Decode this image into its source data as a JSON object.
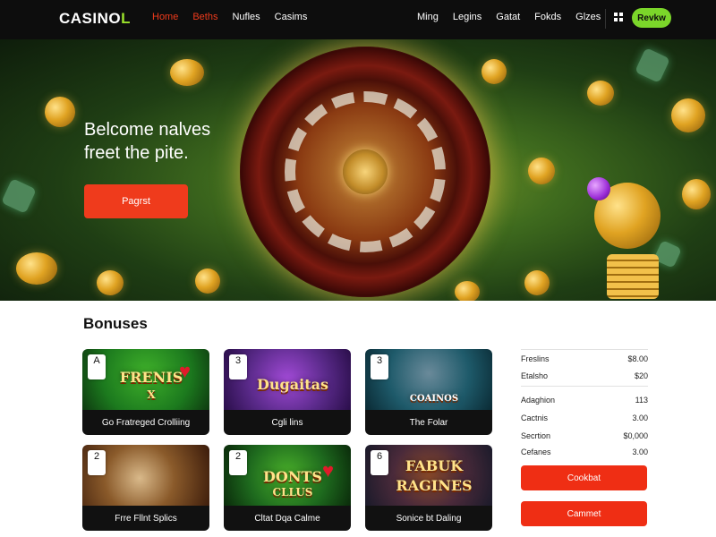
{
  "brand": {
    "logo_main": "CASINO",
    "logo_accent": "L",
    "accent_color": "#9be22b"
  },
  "nav": {
    "left_links": [
      {
        "label": "Home",
        "color": "#ef3b1c"
      },
      {
        "label": "Beths",
        "color": "#ef3b1c"
      },
      {
        "label": "Nufles",
        "color": "#ffffff"
      },
      {
        "label": "Casims",
        "color": "#ffffff"
      }
    ],
    "right_links": [
      "Ming",
      "Legins",
      "Gatat",
      "Fokds",
      "Glzes"
    ],
    "grid_icon": "grid-icon",
    "review_button": "Revkw"
  },
  "hero": {
    "title_line1": "Belcome nalves",
    "title_line2": "freet the pite.",
    "cta_label": "Pagrst"
  },
  "bonuses": {
    "title": "Bonuses",
    "cards": [
      {
        "art_text": "FRENIS",
        "art_sub": "X",
        "card_rank": "A",
        "caption": "Go Fratreged Crolliing",
        "bg": "#1c7a1e"
      },
      {
        "art_text": "Dugaitas",
        "art_sub": "",
        "card_rank": "3",
        "caption": "Cgli lins",
        "bg": "#5a2a8a"
      },
      {
        "art_text": "COAINOS",
        "art_sub": "",
        "card_rank": "3",
        "caption": "The Folar",
        "bg": "#1e5a6a"
      },
      {
        "art_text": "",
        "art_sub": "",
        "card_rank": "2",
        "caption": "Frre Fllnt Splics",
        "bg": "#6a3a1a"
      },
      {
        "art_text": "DONTS",
        "art_sub": "CLLUS",
        "card_rank": "2",
        "caption": "Cltat Dqa Calme",
        "bg": "#1e6a1e"
      },
      {
        "art_text": "FABUK",
        "art_sub": "RAGINES",
        "card_rank": "6",
        "caption": "Sonice bt Daling",
        "bg": "#2a2a4a"
      }
    ]
  },
  "sidebar": {
    "rows_top": [
      {
        "label": "Freslins",
        "value": "$8.00"
      },
      {
        "label": "Etalsho",
        "value": "$20"
      }
    ],
    "rows_bottom": [
      {
        "label": "Adaghion",
        "value": "113"
      },
      {
        "label": "Cactnis",
        "value": "3.00"
      },
      {
        "label": "Secrtion",
        "value": "$0,000"
      },
      {
        "label": "Cefanes",
        "value": "3.00"
      }
    ],
    "button_primary": "Cookbat",
    "button_secondary": "Cammet"
  }
}
